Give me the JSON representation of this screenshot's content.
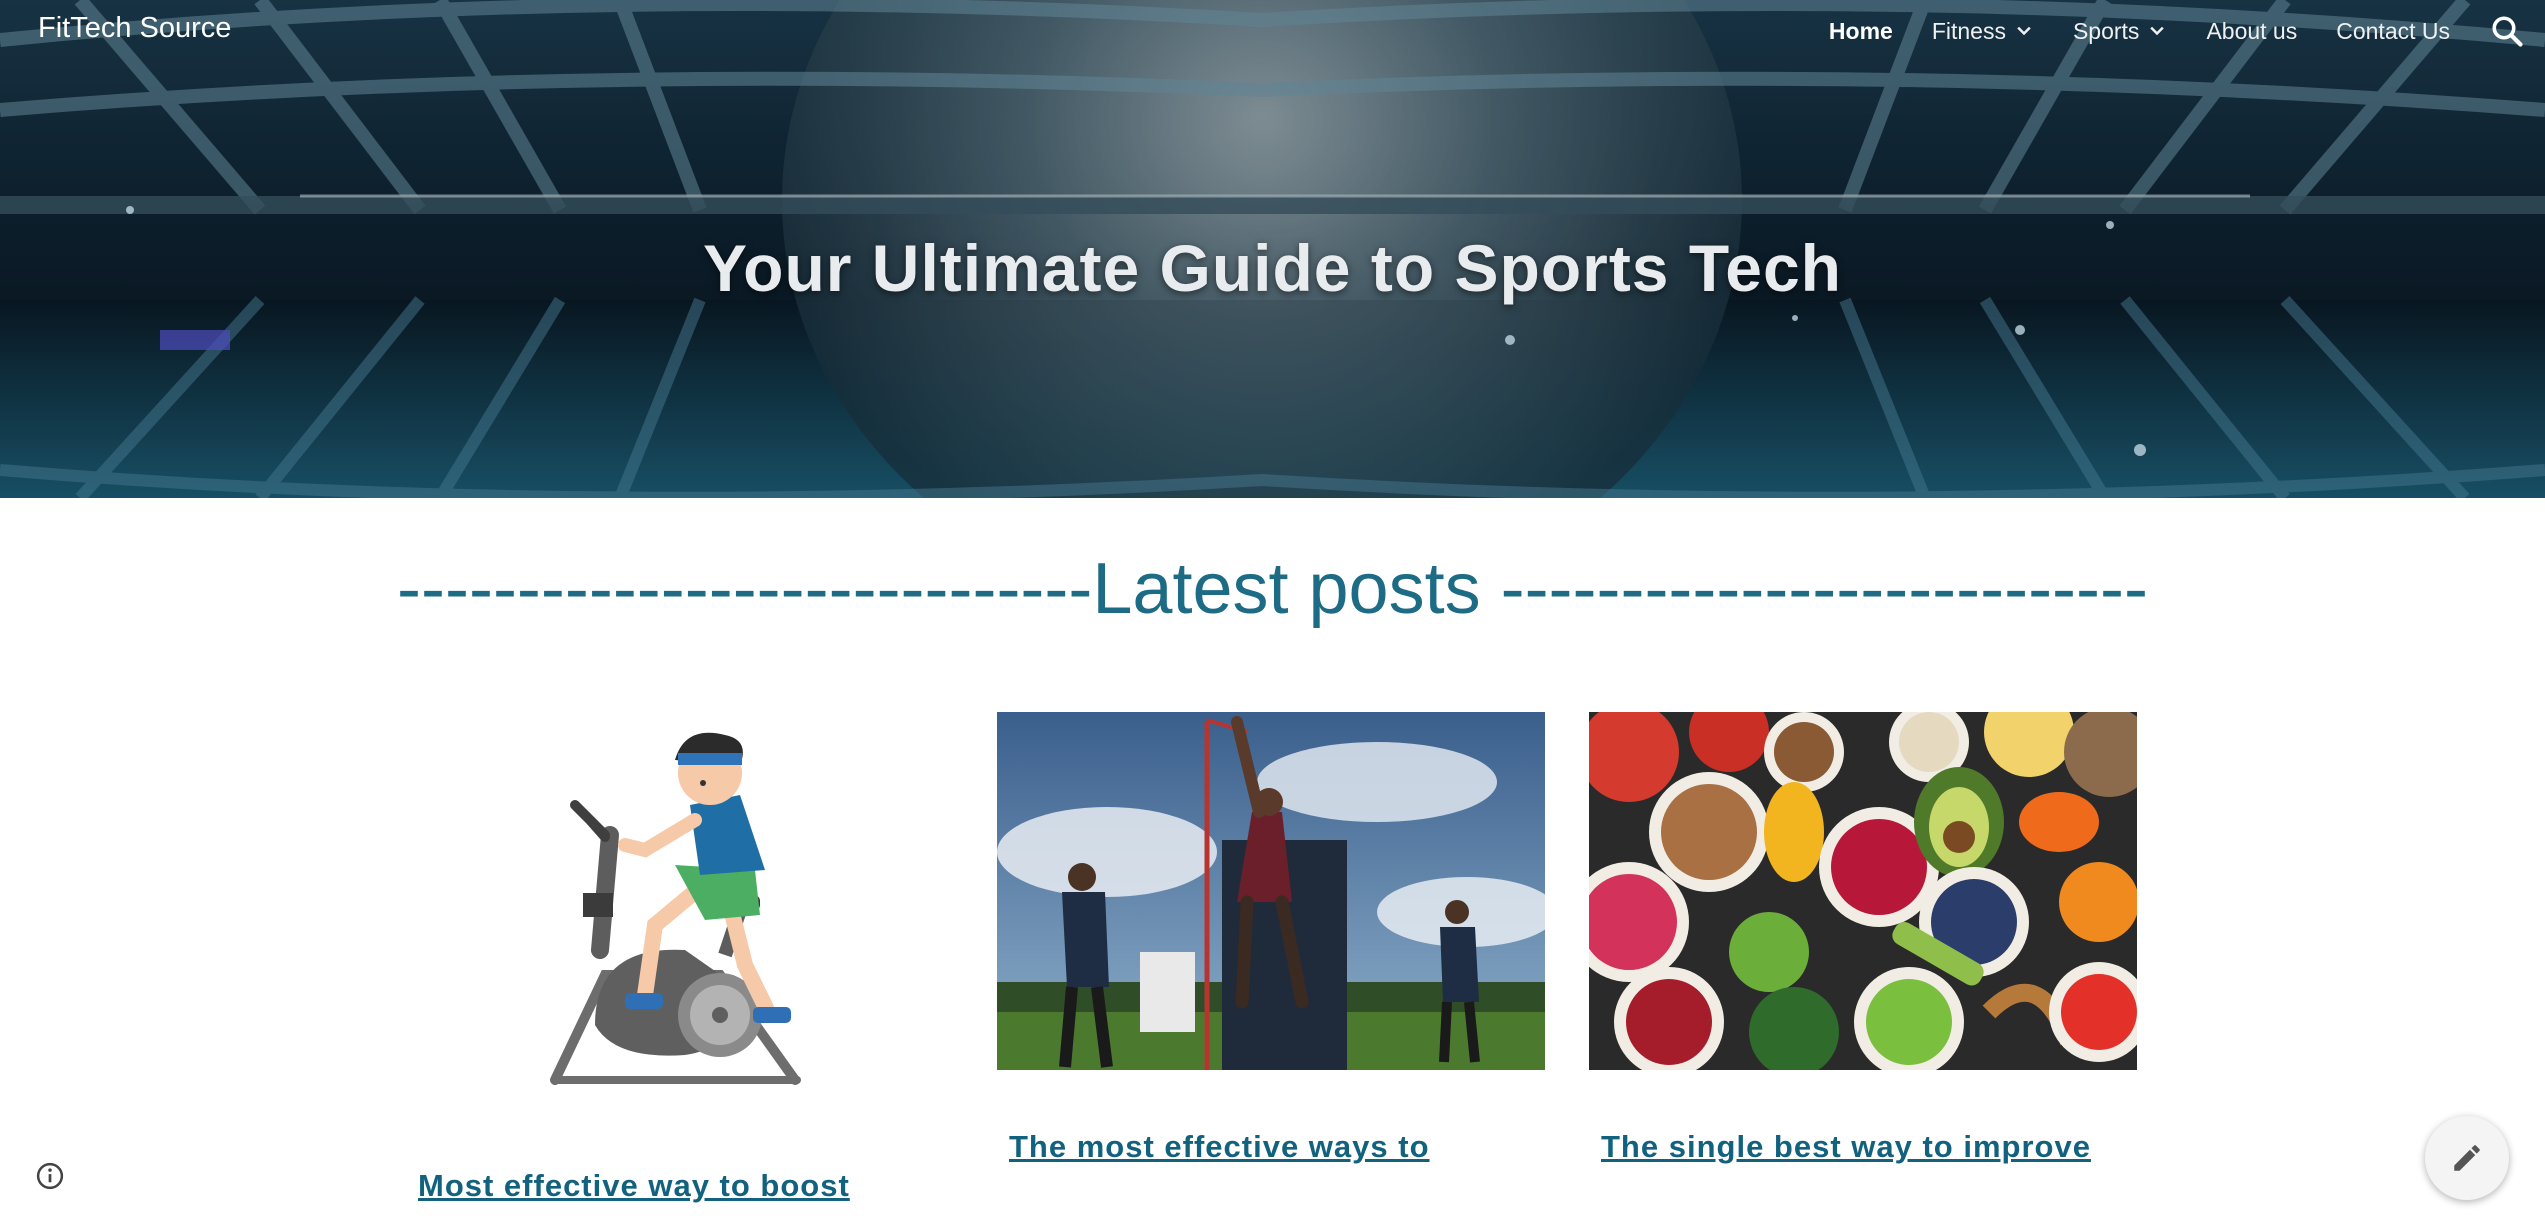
{
  "site": {
    "title": "FitTech Source"
  },
  "nav": {
    "items": [
      {
        "label": "Home",
        "active": true,
        "dropdown": false
      },
      {
        "label": "Fitness",
        "active": false,
        "dropdown": true
      },
      {
        "label": "Sports",
        "active": false,
        "dropdown": true
      },
      {
        "label": "About us",
        "active": false,
        "dropdown": false
      },
      {
        "label": "Contact Us",
        "active": false,
        "dropdown": false
      }
    ],
    "search_icon": "search-icon"
  },
  "hero": {
    "title": "Your Ultimate Guide to Sports Tech"
  },
  "latest": {
    "heading": "-----------------------------Latest posts ---------------------------",
    "posts": [
      {
        "title": "Most effective way to boost",
        "image": "exercise-bike-illustration"
      },
      {
        "title": "The most effective ways to",
        "image": "vertical-jump-photo"
      },
      {
        "title": "The single best way to improve",
        "image": "healthy-food-bowls-photo"
      }
    ]
  },
  "colors": {
    "accent": "#1e6b85",
    "link": "#12627f"
  },
  "icons": {
    "info": "info-icon",
    "edit": "pencil-icon"
  }
}
